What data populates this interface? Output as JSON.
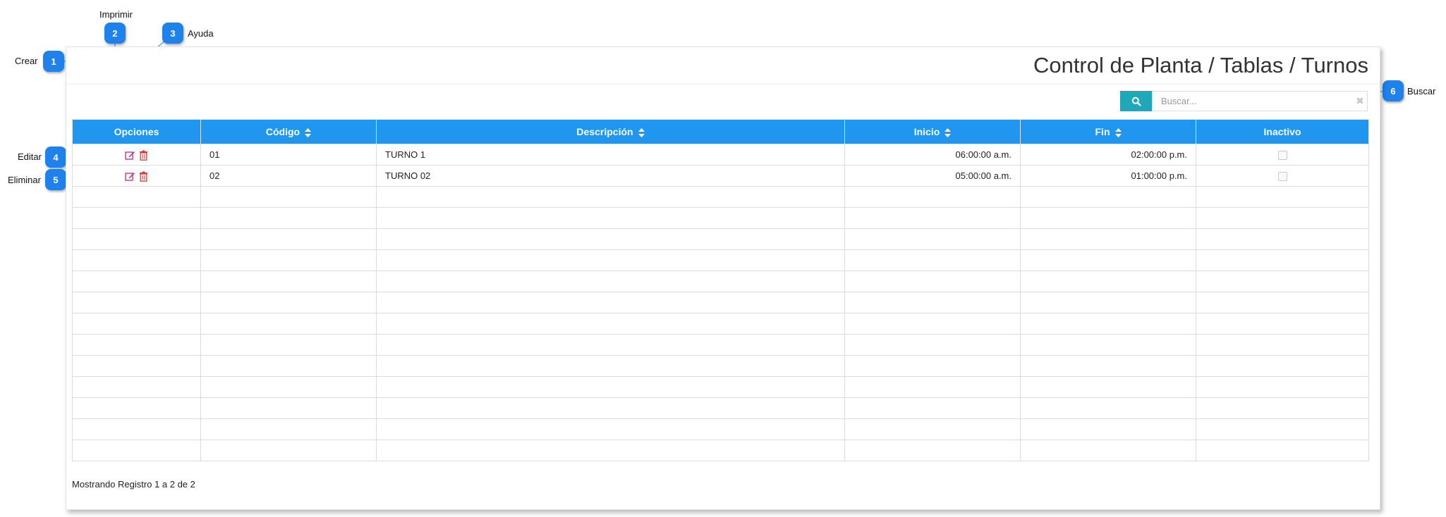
{
  "app": {
    "title": "Control de Planta / Tablas / Turnos"
  },
  "callouts": [
    {
      "number": "1",
      "label": "Crear"
    },
    {
      "number": "2",
      "label": "Imprimir"
    },
    {
      "number": "3",
      "label": "Ayuda"
    },
    {
      "number": "4",
      "label": "Editar"
    },
    {
      "number": "5",
      "label": "Eliminar"
    },
    {
      "number": "6",
      "label": "Buscar"
    }
  ],
  "toolbar": {
    "create_icon": "plus-circle-icon",
    "print_icon": "print-icon",
    "help_icon": "question-circle-icon",
    "accent_color": "#1a9a8a"
  },
  "search": {
    "placeholder": "Buscar...",
    "value": "",
    "button_icon": "search-icon",
    "clear_icon": "close-icon"
  },
  "table": {
    "header_color": "#2196ef",
    "columns": [
      {
        "label": "Opciones",
        "sortable": false
      },
      {
        "label": "Código",
        "sortable": true
      },
      {
        "label": "Descripción",
        "sortable": true
      },
      {
        "label": "Inicio",
        "sortable": true
      },
      {
        "label": "Fin",
        "sortable": true
      },
      {
        "label": "Inactivo",
        "sortable": false
      }
    ],
    "rows": [
      {
        "codigo": "01",
        "descripcion": "TURNO 1",
        "inicio": "06:00:00 a.m.",
        "fin": "02:00:00 p.m.",
        "inactivo": false
      },
      {
        "codigo": "02",
        "descripcion": "TURNO 02",
        "inicio": "05:00:00 a.m.",
        "fin": "01:00:00 p.m.",
        "inactivo": false
      }
    ],
    "empty_rows": 13
  },
  "footer": {
    "records_text": "Mostrando Registro 1 a 2 de 2"
  }
}
